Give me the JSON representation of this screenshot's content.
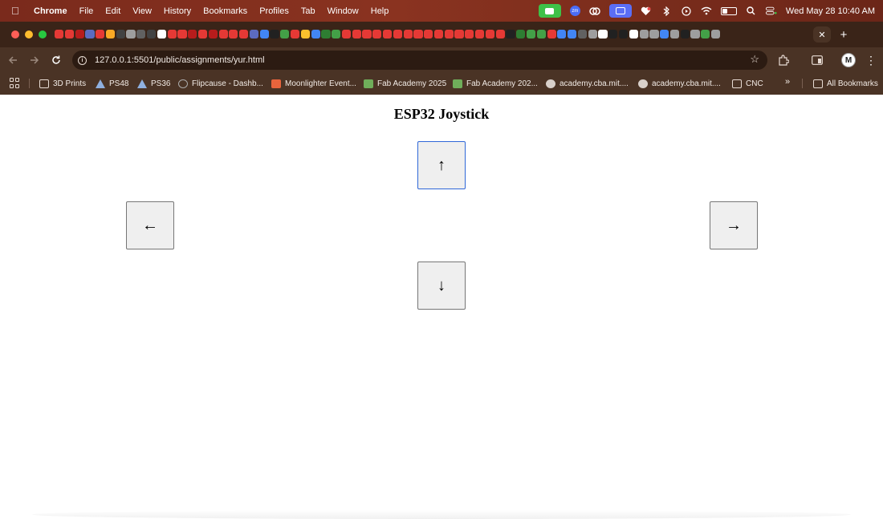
{
  "menubar": {
    "app_name": "Chrome",
    "items": [
      "File",
      "Edit",
      "View",
      "History",
      "Bookmarks",
      "Profiles",
      "Tab",
      "Window",
      "Help"
    ],
    "clock": "Wed May 28  10:40 AM",
    "zoom_label": "zm"
  },
  "tabs": {
    "close_glyph": "✕",
    "new_tab_glyph": "+"
  },
  "toolbar": {
    "url": "127.0.0.1:5501/public/assignments/yur.html",
    "info_glyph": "i",
    "star_glyph": "☆",
    "profile_initial": "M"
  },
  "bookmarks": {
    "items": [
      {
        "label": "3D Prints",
        "icon": "folder-icon"
      },
      {
        "label": "PS48",
        "icon": "triangle-icon"
      },
      {
        "label": "PS36",
        "icon": "triangle-icon"
      },
      {
        "label": "Flipcause - Dashb...",
        "icon": "circle-icon"
      },
      {
        "label": "Moonlighter Event...",
        "icon": "flag-icon"
      },
      {
        "label": "Fab Academy 2025",
        "icon": "fab-icon"
      },
      {
        "label": "Fab Academy 202...",
        "icon": "fab-icon"
      },
      {
        "label": "academy.cba.mit....",
        "icon": "globe-icon"
      },
      {
        "label": "academy.cba.mit....",
        "icon": "globe-icon"
      },
      {
        "label": "CNC",
        "icon": "folder-icon"
      }
    ],
    "more_glyph": "»",
    "all_bookmarks": "All Bookmarks"
  },
  "page": {
    "title": "ESP32 Joystick",
    "up_label": "↑",
    "left_label": "←",
    "right_label": "→",
    "down_label": "↓"
  },
  "colors": {
    "menubar": "#8a3320",
    "tabstrip": "#3a2418",
    "toolbar": "#4a3325",
    "button_bg": "#efefef",
    "focus_ring": "#2f67d8"
  }
}
